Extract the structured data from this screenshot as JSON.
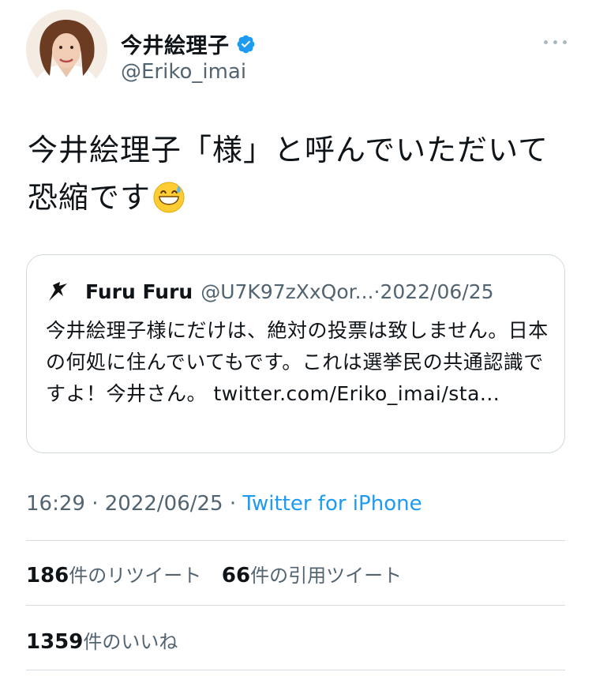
{
  "author": {
    "name": "今井絵理子",
    "handle": "@Eriko_imai"
  },
  "tweet": {
    "text": "今井絵理子「様」と呼んでいただいて恐縮です",
    "emoji": "grinning-face-with-sweat-emoji"
  },
  "quoted": {
    "name": "Furu Furu",
    "handle": "@U7K97zXxQor...",
    "sep": " · ",
    "date": "2022/06/25",
    "text": "今井絵理子様にだけは、絶対の投票は致しません。日本の何処に住んでいてもです。これは選挙民の共通認識ですよ！今井さん。 twitter.com/Eriko_imai/sta..."
  },
  "meta": {
    "time": "16:29",
    "sep1": " · ",
    "date": "2022/06/25",
    "sep2": " · ",
    "source": "Twitter for iPhone"
  },
  "stats": {
    "retweets_count": "186",
    "retweets_label": "件のリツイート",
    "quotes_count": "66",
    "quotes_label": "件の引用ツイート",
    "likes_count": "1359",
    "likes_label": "件のいいね"
  },
  "colors": {
    "accent": "#1d9bf0",
    "secondary_text": "#536471",
    "border": "#cfd9de"
  }
}
